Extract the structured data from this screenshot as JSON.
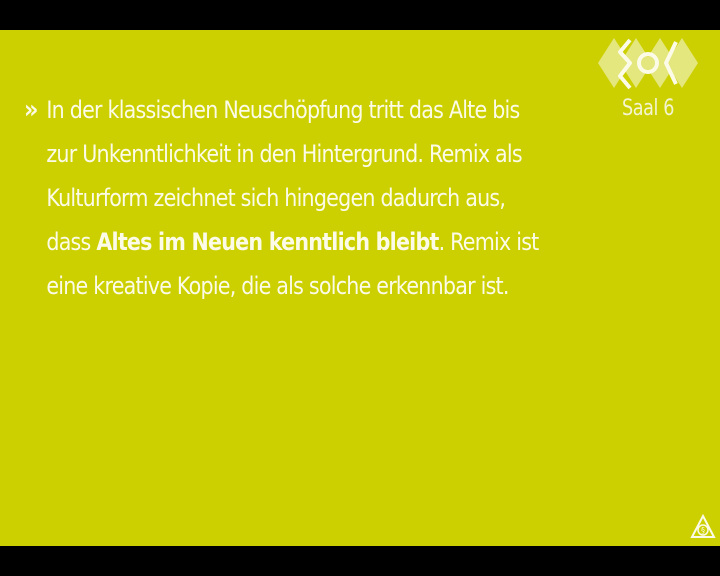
{
  "slide": {
    "quote_mark": "»",
    "lines": {
      "l1": "In der klassischen Neuschöpfung tritt das Alte bis",
      "l2": "zur Unkenntlichkeit in den Hintergrund. Remix als",
      "l3": "Kulturform zeichnet sich hingegen dadurch aus,",
      "l4_pre": "dass ",
      "l4_bold": "Altes im Neuen kenntlich bleibt",
      "l4_post": ". Remix ist",
      "l5": "eine kreative Kopie, die als solche erkennbar ist."
    },
    "room_label": "Saal 6",
    "background_color": "#cdd000",
    "text_color": "#fbfbe8",
    "icons": {
      "logo": "event-logo-icon",
      "license": "copyright-triangle-icon"
    }
  }
}
